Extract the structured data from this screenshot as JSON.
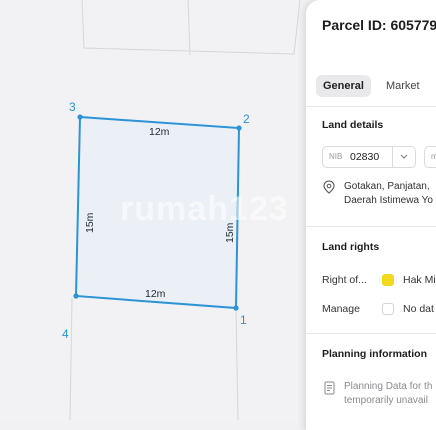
{
  "map": {
    "polygon_color": "#2b93d6",
    "fill_color": "#eaf0f6",
    "vertices": [
      "1",
      "2",
      "3",
      "4"
    ],
    "edges": {
      "top": "12m",
      "bottom": "12m",
      "left": "15m",
      "right": "15m"
    },
    "watermark": "rumah123"
  },
  "panel": {
    "parcel_id": "Parcel ID: 605779",
    "tabs": [
      {
        "label": "General",
        "active": true
      },
      {
        "label": "Market",
        "active": false
      }
    ],
    "land_details": {
      "title": "Land details",
      "nib_label": "NIB",
      "nib_value": "02830",
      "second_field_label": "m",
      "address_line1": "Gotakan, Panjatan,",
      "address_line2": "Daerah Istimewa Yo"
    },
    "land_rights": {
      "title": "Land rights",
      "right_of_label": "Right of...",
      "right_of_value": "Hak Mi",
      "right_of_color": "#f2d91d",
      "manage_label": "Manage",
      "manage_value": "No dat"
    },
    "planning": {
      "title": "Planning information",
      "line1": "Planning Data for th",
      "line2": "temporarily unavail"
    }
  }
}
